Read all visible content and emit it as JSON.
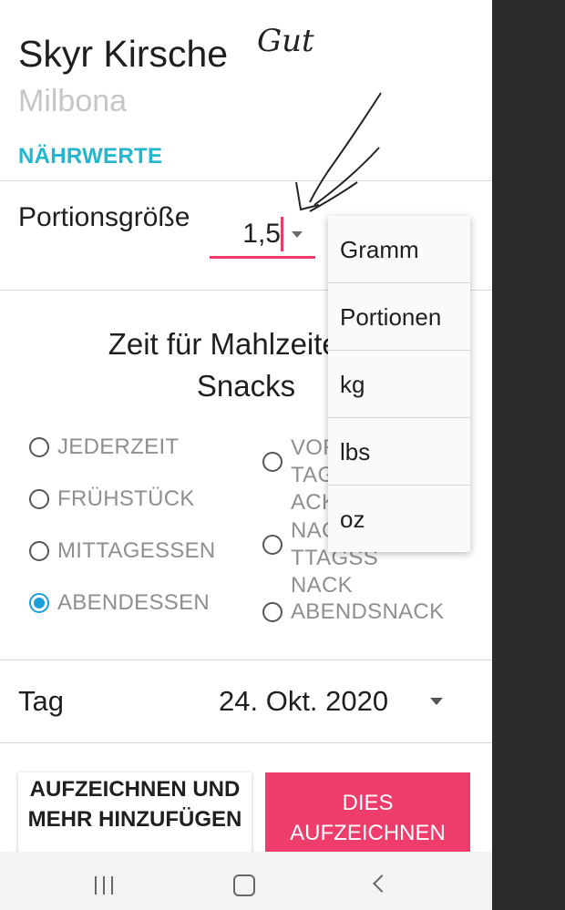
{
  "product": {
    "name": "Skyr Kirsche",
    "brand": "Milbona"
  },
  "nutrition_link": "NÄHRWERTE",
  "portion": {
    "label": "Portionsgröße",
    "value": "1,5"
  },
  "unit_dropdown": {
    "options": [
      "Gramm",
      "Portionen",
      "kg",
      "lbs",
      "oz"
    ]
  },
  "meal_time": {
    "heading": "Zeit für Mahlzeiten & Snacks",
    "options_left": [
      {
        "label": "JEDERZEIT",
        "selected": false
      },
      {
        "label": "FRÜHSTÜCK",
        "selected": false
      },
      {
        "label": "MITTAGESSEN",
        "selected": false
      },
      {
        "label": "ABENDESSEN",
        "selected": true
      }
    ],
    "options_right": [
      {
        "label": "VORMITTAGSSNACK",
        "selected": false
      },
      {
        "label": "NACHMITTAGSSNACK",
        "selected": false
      },
      {
        "label": "ABENDSNACK",
        "selected": false
      }
    ]
  },
  "day": {
    "label": "Tag",
    "value": "24. Okt. 2020"
  },
  "buttons": {
    "record_and_add": "AUFZEICHNEN UND MEHR HINZUFÜGEN",
    "record": "DIES AUFZEICHNEN"
  },
  "annotation": {
    "handwriting": "Gut"
  },
  "colors": {
    "accent_pink": "#ee3d6b",
    "accent_cyan": "#22b6cf",
    "radio_blue": "#1aa0d8"
  }
}
